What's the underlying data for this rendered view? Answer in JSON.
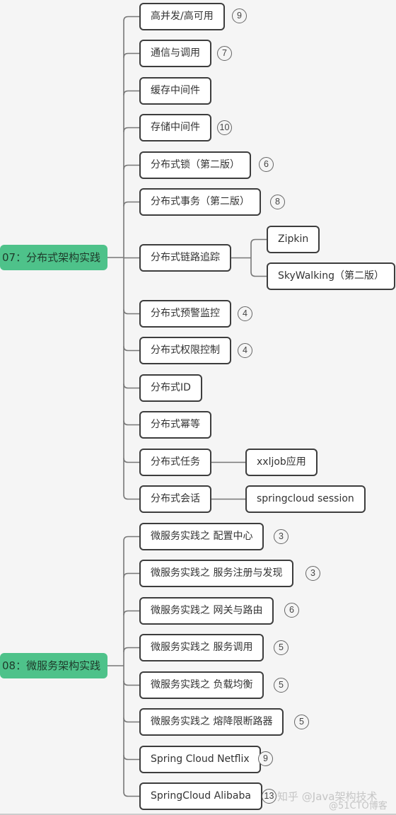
{
  "roots": [
    {
      "label": "07：分布式架构实践",
      "children": [
        {
          "label": "高并发/高可用",
          "count": "9"
        },
        {
          "label": "通信与调用",
          "count": "7"
        },
        {
          "label": "缓存中间件",
          "count": null
        },
        {
          "label": "存储中间件",
          "count": "10"
        },
        {
          "label": "分布式锁（第二版）",
          "count": "6"
        },
        {
          "label": "分布式事务（第二版）",
          "count": "8"
        },
        {
          "label": "分布式链路追踪",
          "count": null,
          "children": [
            {
              "label": "Zipkin"
            },
            {
              "label": "SkyWalking（第二版）"
            }
          ]
        },
        {
          "label": "分布式预警监控",
          "count": "4"
        },
        {
          "label": "分布式权限控制",
          "count": "4"
        },
        {
          "label": "分布式ID",
          "count": null
        },
        {
          "label": "分布式幂等",
          "count": null
        },
        {
          "label": "分布式任务",
          "count": null,
          "children": [
            {
              "label": "xxljob应用"
            }
          ]
        },
        {
          "label": "分布式会话",
          "count": null,
          "children": [
            {
              "label": "springcloud session"
            }
          ]
        }
      ]
    },
    {
      "label": "08：微服务架构实践",
      "children": [
        {
          "label": "微服务实践之 配置中心",
          "count": "3"
        },
        {
          "label": "微服务实践之 服务注册与发现",
          "count": "3"
        },
        {
          "label": "微服务实践之 网关与路由",
          "count": "6"
        },
        {
          "label": "微服务实践之 服务调用",
          "count": "5"
        },
        {
          "label": "微服务实践之 负载均衡",
          "count": "5"
        },
        {
          "label": "微服务实践之 熔降限断路器",
          "count": "5"
        },
        {
          "label": "Spring Cloud Netflix",
          "count": "9"
        },
        {
          "label": "SpringCloud Alibaba",
          "count": "13"
        }
      ]
    }
  ],
  "watermarks": [
    "知乎 @Java架构技术",
    "@51CTO博客"
  ],
  "colors": {
    "root_fill": "#4ec28a",
    "node_border": "#3d3d3d",
    "line": "#777777",
    "background": "#f5f5f5"
  }
}
